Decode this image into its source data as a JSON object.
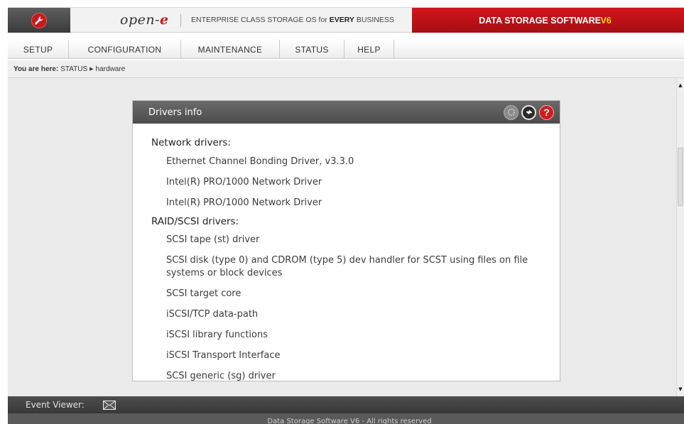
{
  "header": {
    "logo_main": "open-",
    "logo_suffix": "e",
    "tagline_prefix": "ENTERPRISE CLASS STORAGE OS for ",
    "tagline_bold": "EVERY",
    "tagline_suffix": " BUSINESS",
    "brand_text": "DATA STORAGE SOFTWARE ",
    "brand_version": "V6",
    "brand_color": "#c8181f",
    "version_color": "#ffd200",
    "tool_icon": "wrench-icon"
  },
  "nav": {
    "items": [
      {
        "label": "SETUP"
      },
      {
        "label": "CONFIGURATION"
      },
      {
        "label": "MAINTENANCE"
      },
      {
        "label": "STATUS"
      },
      {
        "label": "HELP"
      }
    ]
  },
  "breadcrumb": {
    "prefix": "You are here:",
    "section": "STATUS",
    "page": "hardware"
  },
  "panel": {
    "title": "Drivers info",
    "icons": [
      "gear-icon",
      "refresh-icon",
      "help-icon"
    ],
    "help_glyph": "?",
    "sections": [
      {
        "heading": "Network drivers:",
        "items": [
          "Ethernet Channel Bonding Driver, v3.3.0",
          "Intel(R) PRO/1000 Network Driver",
          "Intel(R) PRO/1000 Network Driver"
        ]
      },
      {
        "heading": "RAID/SCSI drivers:",
        "items": [
          "SCSI tape (st) driver",
          "SCSI disk (type 0) and CDROM (type 5) dev handler for SCST using files on file systems or block devices",
          "SCSI target core",
          "iSCSI/TCP data-path",
          "iSCSI library functions",
          "iSCSI Transport Interface",
          "SCSI generic (sg) driver"
        ]
      }
    ]
  },
  "event_viewer": {
    "label": "Event Viewer:",
    "icon": "mail-icon"
  },
  "footer": {
    "text": "Data Storage Software V6 - All rights reserved"
  }
}
